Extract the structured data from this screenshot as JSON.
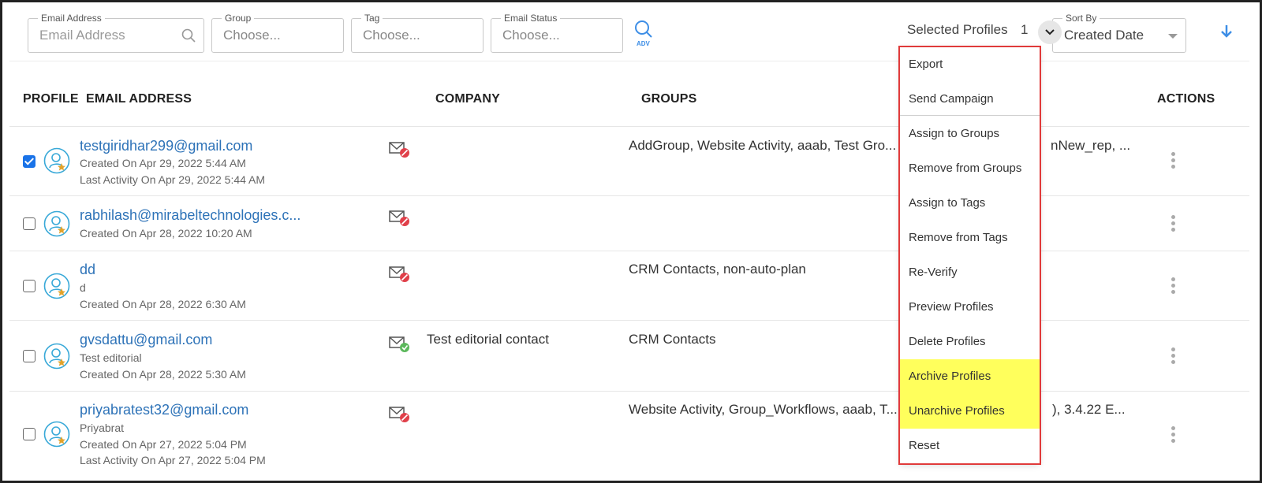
{
  "filters": {
    "email_label": "Email Address",
    "email_placeholder": "Email Address",
    "group_label": "Group",
    "group_value": "Choose...",
    "tag_label": "Tag",
    "tag_value": "Choose...",
    "status_label": "Email Status",
    "status_value": "Choose...",
    "adv_label": "ADV"
  },
  "selection": {
    "label": "Selected Profiles",
    "count": "1"
  },
  "sort": {
    "label": "Sort By",
    "value": "Created Date"
  },
  "headers": {
    "profile": "PROFILE",
    "email": "EMAIL ADDRESS",
    "company": "COMPANY",
    "groups": "GROUPS",
    "actions": "ACTIONS"
  },
  "rows": [
    {
      "checked": true,
      "email": "testgiridhar299@gmail.com",
      "line2": "Created On Apr 29, 2022 5:44 AM",
      "line3": "Last Activity On Apr 29, 2022 5:44 AM",
      "mail_status": "blocked",
      "company": "",
      "groups": "AddGroup, Website Activity, aaab, Test Gro...",
      "groups_tail": "nNew_rep, ..."
    },
    {
      "checked": false,
      "email": "rabhilash@mirabeltechnologies.c...",
      "line2": "Created On Apr 28, 2022 10:20 AM",
      "line3": "",
      "mail_status": "blocked",
      "company": "",
      "groups": "",
      "groups_tail": ""
    },
    {
      "checked": false,
      "email": "dd",
      "line2": "d",
      "line3": "Created On Apr 28, 2022 6:30 AM",
      "mail_status": "blocked",
      "company": "",
      "groups": "CRM Contacts, non-auto-plan",
      "groups_tail": ""
    },
    {
      "checked": false,
      "email": "gvsdattu@gmail.com",
      "line2": "Test editorial",
      "line3": "Created On Apr 28, 2022 5:30 AM",
      "mail_status": "verified",
      "company": "Test editorial contact",
      "groups": "CRM Contacts",
      "groups_tail": ""
    },
    {
      "checked": false,
      "email": "priyabratest32@gmail.com",
      "line2": "Priyabrat",
      "line3": "Created On Apr 27, 2022 5:04 PM",
      "line4": "Last Activity On Apr 27, 2022 5:04 PM",
      "mail_status": "blocked",
      "company": "",
      "groups": "Website Activity, Group_Workflows, aaab, T...",
      "groups_tail": "), 3.4.22 E..."
    }
  ],
  "menu": [
    {
      "label": "Export",
      "highlight": false
    },
    {
      "label": "Send Campaign",
      "highlight": false
    },
    {
      "label": "Assign to Groups",
      "highlight": false
    },
    {
      "label": "Remove from Groups",
      "highlight": false
    },
    {
      "label": "Assign to Tags",
      "highlight": false
    },
    {
      "label": "Remove from Tags",
      "highlight": false
    },
    {
      "label": "Re-Verify",
      "highlight": false
    },
    {
      "label": "Preview Profiles",
      "highlight": false
    },
    {
      "label": "Delete Profiles",
      "highlight": false
    },
    {
      "label": "Archive Profiles",
      "highlight": true
    },
    {
      "label": "Unarchive Profiles",
      "highlight": true
    },
    {
      "label": "Reset",
      "highlight": false
    }
  ],
  "colors": {
    "link": "#2e73b8",
    "accent": "#1a73e8",
    "highlight": "#ffff5c",
    "outline": "#e03a3a",
    "blocked": "#e0404a",
    "verified": "#5cb85c"
  }
}
